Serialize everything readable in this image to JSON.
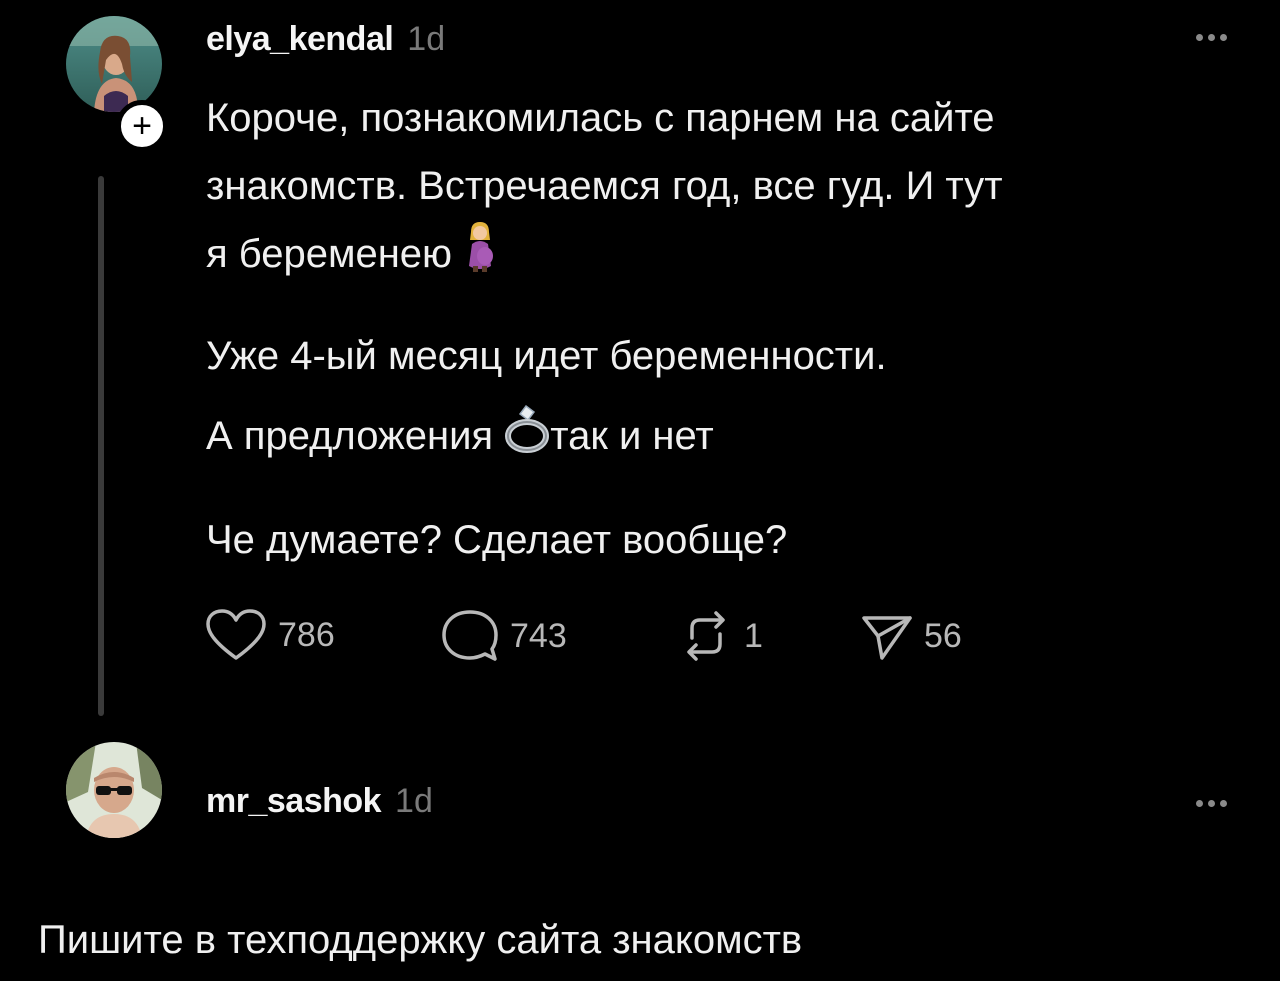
{
  "post": {
    "username": "elya_kendal",
    "timestamp": "1d",
    "lines": [
      "Короче, познакомилась с парнем на сайте",
      "знакомств. Встречаемся год, все гуд. И тут",
      "я беременею",
      "Уже 4-ый месяц идет беременности.",
      "А предложения",
      "так и нет",
      "Че думаете? Сделает вообще?"
    ],
    "emojis": [
      "pregnant-woman-emoji",
      "ring-emoji"
    ],
    "actions": {
      "likes": "786",
      "replies": "743",
      "reposts": "1",
      "shares": "56"
    }
  },
  "reply": {
    "username": "mr_sashok",
    "timestamp": "1d",
    "text": "Пишите в техподдержку сайта знакомств"
  },
  "colors": {
    "background": "#000000",
    "text": "#f0f0f0",
    "muted": "#7a7a7a",
    "thread_line": "#3a3a3a"
  }
}
